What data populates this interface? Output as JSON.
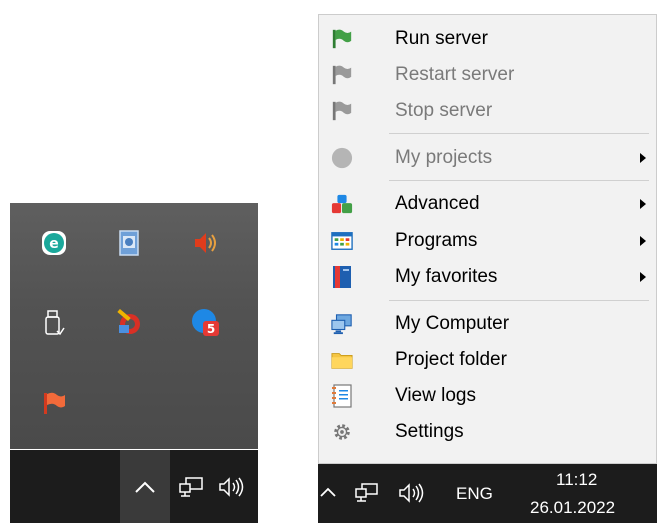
{
  "tray_flyout": {
    "icons": [
      {
        "name": "eset-icon"
      },
      {
        "name": "document-app-icon"
      },
      {
        "name": "speaker-muted-icon"
      },
      {
        "name": "usb-drive-icon"
      },
      {
        "name": "ccleaner-icon"
      },
      {
        "name": "notification-badge-icon",
        "badge": "5"
      },
      {
        "name": "server-flag-icon"
      }
    ]
  },
  "menu": {
    "items": [
      {
        "label": "Run server",
        "icon": "green-flag-icon",
        "enabled": true
      },
      {
        "label": "Restart server",
        "icon": "gray-flag-icon",
        "enabled": false
      },
      {
        "label": "Stop server",
        "icon": "gray-flag-icon",
        "enabled": false
      },
      {
        "label": "My projects",
        "icon": "gray-circle-icon",
        "enabled": false,
        "submenu": true
      },
      {
        "label": "Advanced",
        "icon": "blocks-icon",
        "enabled": true,
        "submenu": true
      },
      {
        "label": "Programs",
        "icon": "programs-grid-icon",
        "enabled": true,
        "submenu": true
      },
      {
        "label": "My favorites",
        "icon": "favorites-book-icon",
        "enabled": true,
        "submenu": true
      },
      {
        "label": "My Computer",
        "icon": "computer-icon",
        "enabled": true
      },
      {
        "label": "Project folder",
        "icon": "folder-icon",
        "enabled": true
      },
      {
        "label": "View logs",
        "icon": "log-notebook-icon",
        "enabled": true
      },
      {
        "label": "Settings",
        "icon": "gear-icon",
        "enabled": true
      }
    ]
  },
  "taskbar": {
    "language": "ENG",
    "time": "11:12",
    "date": "26.01.2022"
  },
  "colors": {
    "menu_bg": "#f2f2f2",
    "taskbar_bg": "#1c1c1c",
    "flyout_bg": "#555555",
    "disabled_text": "#7a7a7a"
  }
}
